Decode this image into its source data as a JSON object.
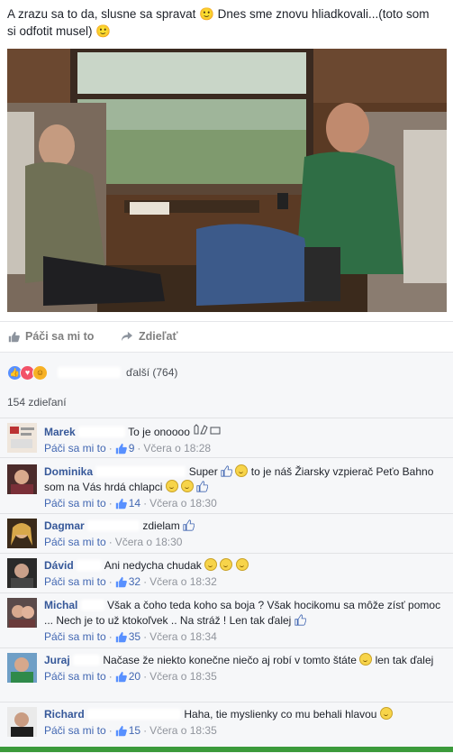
{
  "post": {
    "text": "A zrazu sa to da, slusne sa spravat 🙂 Dnes sme znovu hliadkovali...(toto som si odfotit musel) 🙂"
  },
  "actions": {
    "like_label": "Páči sa mi to",
    "share_label": "Zdieľať"
  },
  "reactions": {
    "others_label": "ďalší (764)",
    "shares_label": "154 zdieľaní"
  },
  "comments": [
    {
      "name": "Marek",
      "text": "To je onoooo",
      "like_label": "Páči sa mi to",
      "likes": "9",
      "time": "Včera o 18:28"
    },
    {
      "name": "Dominika",
      "text": "Super",
      "text2": "to je náš Žiarsky vzpierač Peťo Bahno som na Vás hrdá chlapci",
      "like_label": "Páči sa mi to",
      "likes": "14",
      "time": "Včera o 18:30"
    },
    {
      "name": "Dagmar",
      "text": "zdielam",
      "like_label": "Páči sa mi to",
      "time": "Včera o 18:30"
    },
    {
      "name": "Dávid",
      "text": "Ani nedycha chudak",
      "like_label": "Páči sa mi to",
      "likes": "32",
      "time": "Včera o 18:32"
    },
    {
      "name": "Michal",
      "text": "Však a čoho teda koho sa boja ? Však hocikomu sa môže zísť pomoc ... Nech je to už ktokoľvek .. Na stráž ! Len tak ďalej",
      "like_label": "Páči sa mi to",
      "likes": "35",
      "time": "Včera o 18:34"
    },
    {
      "name": "Juraj",
      "text": "Načase že niekto konečne niečo aj robí v tomto štáte",
      "text2": "len tak ďalej",
      "like_label": "Páči sa mi to",
      "likes": "20",
      "time": "Včera o 18:35"
    },
    {
      "name": "Richard",
      "text": "Haha, tie myslienky co mu behali hlavou",
      "like_label": "Páči sa mi to",
      "likes": "15",
      "time": "Včera o 18:35"
    }
  ],
  "colors": {
    "link": "#365899",
    "meta": "#90949c",
    "bg": "#f6f7f9",
    "accent": "#4267b2"
  }
}
